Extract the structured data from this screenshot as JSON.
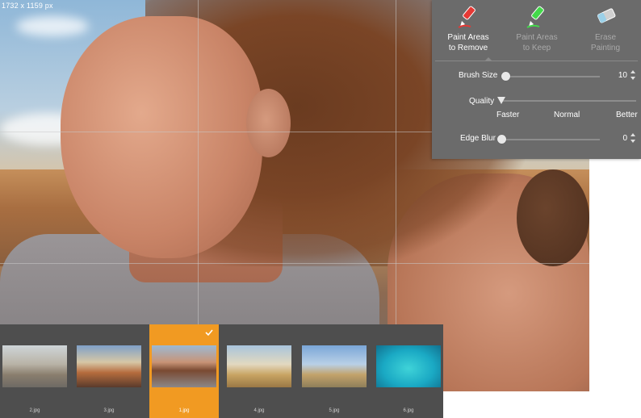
{
  "image_dimensions": "1732 x 1159 px",
  "tools": [
    {
      "name": "Paint Areas to Remove",
      "line1": "Paint Areas",
      "line2": "to Remove",
      "icon": "red-marker-icon",
      "active": true
    },
    {
      "name": "Paint Areas to Keep",
      "line1": "Paint Areas",
      "line2": "to Keep",
      "icon": "green-marker-icon",
      "active": false
    },
    {
      "name": "Erase Painting",
      "line1": "Erase",
      "line2": "Painting",
      "icon": "eraser-icon",
      "active": false
    }
  ],
  "brush_size": {
    "label": "Brush Size",
    "value": "10",
    "fraction": 0.0
  },
  "quality": {
    "label": "Quality",
    "options": [
      "Faster",
      "Normal",
      "Better"
    ],
    "selected": "Faster"
  },
  "edge_blur": {
    "label": "Edge Blur",
    "value": "0",
    "fraction": 0.0
  },
  "filmstrip": [
    {
      "name": "2.jpg",
      "selected": false
    },
    {
      "name": "3.jpg",
      "selected": false
    },
    {
      "name": "1.jpg",
      "selected": true
    },
    {
      "name": "4.jpg",
      "selected": false
    },
    {
      "name": "5.jpg",
      "selected": false
    },
    {
      "name": "6.jpg",
      "selected": false
    }
  ],
  "colors": {
    "accent": "#f19a22",
    "panel": "#6b6b6b",
    "filmstrip": "#4e4e4e",
    "remove_marker": "#e53935",
    "keep_marker": "#43d94a"
  }
}
